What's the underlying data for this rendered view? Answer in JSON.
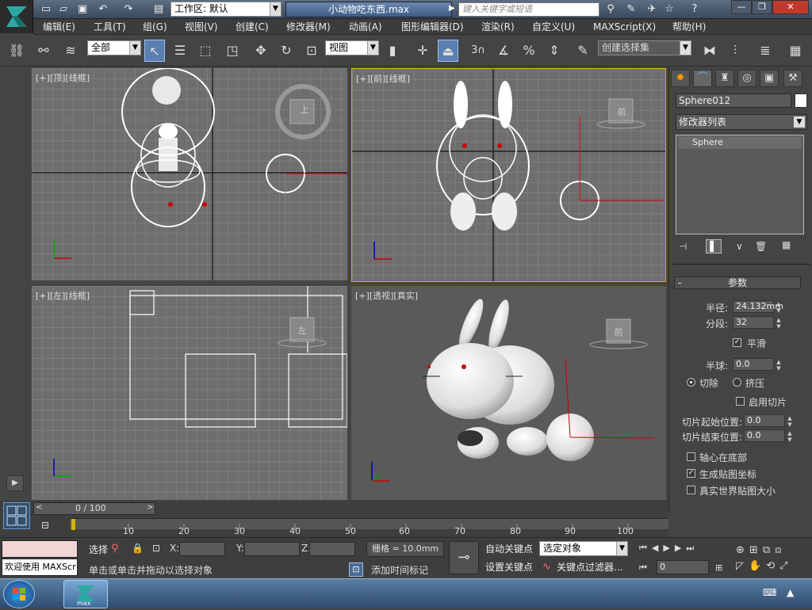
{
  "title": {
    "workspace": "工作区: 默认",
    "document": "小动物吃东西.max",
    "search_placeholder": "键入关键字或短语"
  },
  "menu": [
    "编辑(E)",
    "工具(T)",
    "组(G)",
    "视图(V)",
    "创建(C)",
    "修改器(M)",
    "动画(A)",
    "图形编辑器(D)",
    "渲染(R)",
    "自定义(U)",
    "MAXScript(X)",
    "帮助(H)"
  ],
  "toolbar": {
    "filter": "全部",
    "ref_coord": "视图",
    "snap_num": "3",
    "named_sel": "创建选择集"
  },
  "viewports": {
    "top": {
      "plus": "[+]",
      "name": "[顶]",
      "mode": "[线框]",
      "cube": "上"
    },
    "front": {
      "plus": "[+]",
      "name": "[前]",
      "mode": "[线框]",
      "cube": "前"
    },
    "left": {
      "plus": "[+]",
      "name": "[左]",
      "mode": "[线框]",
      "cube": "左"
    },
    "persp": {
      "plus": "[+]",
      "name": "[透视]",
      "mode": "[真实]",
      "cube": "前"
    }
  },
  "panel": {
    "object_name": "Sphere012",
    "modifier_list": "修改器列表",
    "stack_item": "Sphere",
    "rollout": "参数",
    "radius_label": "半径:",
    "radius": "24.132mm",
    "segments_label": "分段:",
    "segments": "32",
    "smooth": "平滑",
    "hemi_label": "半球:",
    "hemi": "0.0",
    "chop": "切除",
    "squash": "挤压",
    "slice_on": "启用切片",
    "slice_from_label": "切片起始位置:",
    "slice_from": "0.0",
    "slice_to_label": "切片结束位置:",
    "slice_to": "0.0",
    "base_pivot": "轴心在底部",
    "gen_map": "生成贴图坐标",
    "real_world": "真实世界贴图大小"
  },
  "timeline": {
    "frame": "0 / 100",
    "ticks": [
      "10",
      "20",
      "30",
      "40",
      "50",
      "60",
      "70",
      "80",
      "90",
      "100"
    ]
  },
  "status": {
    "maxscript": "欢迎使用 MAXScr",
    "select_label": "选择",
    "x_label": "X:",
    "y_label": "Y:",
    "z_label": "Z:",
    "grid": "栅格 = 10.0mm",
    "prompt": "单击或单击并拖动以选择对象",
    "add_time_tag": "添加时间标记",
    "auto_key": "自动关键点",
    "set_key": "设置关键点",
    "key_mode": "选定对象",
    "key_filters": "关键点过滤器...",
    "frame_field": "0"
  },
  "taskbar": {
    "app": "max"
  }
}
